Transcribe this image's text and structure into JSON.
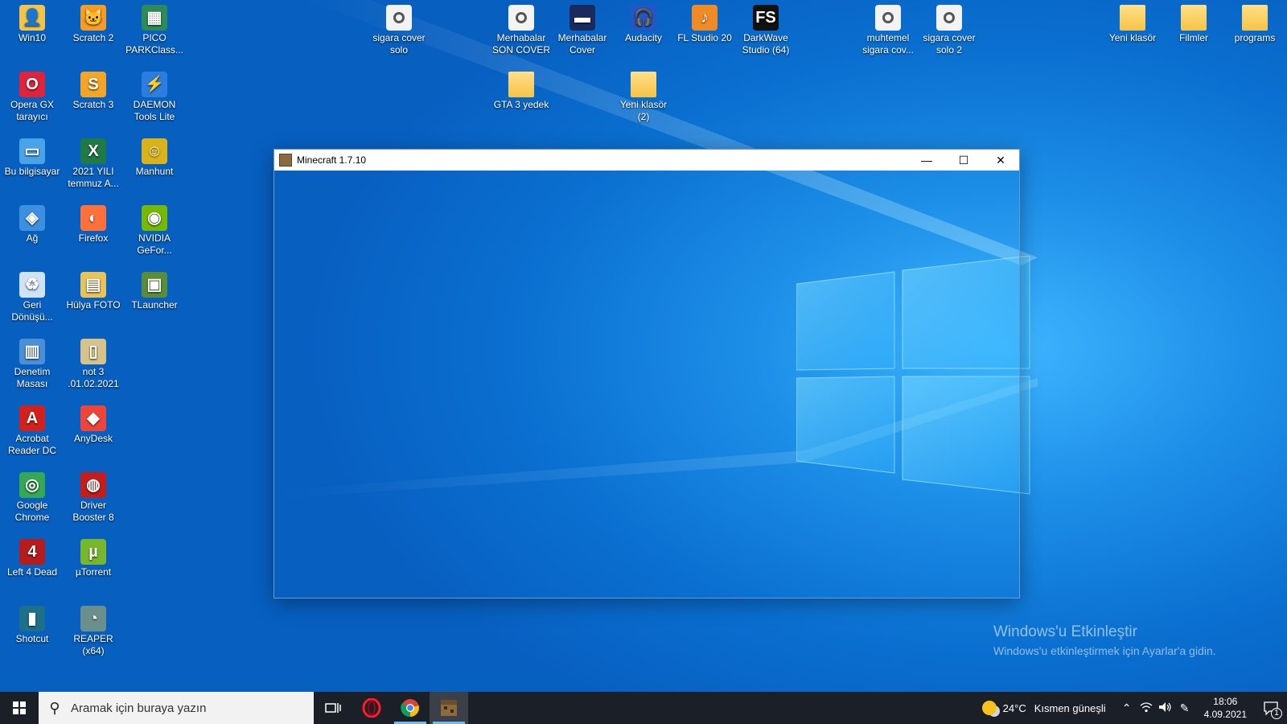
{
  "desktop": {
    "icons": [
      {
        "label": "Win10",
        "icon": "user-folder-icon",
        "color": "#f2c44a"
      },
      {
        "label": "Scratch 2",
        "icon": "scratch-cat-icon",
        "color": "#f79b27"
      },
      {
        "label": "PICO PARKClass...",
        "icon": "pico-park-icon",
        "color": "#2e8b57"
      },
      {
        "label": "Opera GX tarayıcı",
        "icon": "opera-gx-icon",
        "color": "#e0223a"
      },
      {
        "label": "Scratch 3",
        "icon": "scratch3-icon",
        "color": "#f5a524"
      },
      {
        "label": "DAEMON Tools Lite",
        "icon": "daemon-tools-icon",
        "color": "#2a7de1"
      },
      {
        "label": "Bu bilgisayar",
        "icon": "computer-icon",
        "color": "#4aa3e8"
      },
      {
        "label": "2021 YILI temmuz A...",
        "icon": "excel-file-icon",
        "color": "#1f7a45"
      },
      {
        "label": "Manhunt",
        "icon": "manhunt-icon",
        "color": "#d9b317"
      },
      {
        "label": "Ağ",
        "icon": "network-icon",
        "color": "#3d8fe0"
      },
      {
        "label": "Firefox",
        "icon": "firefox-icon",
        "color": "#ff7139"
      },
      {
        "label": "NVIDIA GeFor...",
        "icon": "nvidia-icon",
        "color": "#76b900"
      },
      {
        "label": "Geri Dönüşü...",
        "icon": "recycle-bin-icon",
        "color": "#cfe3f5"
      },
      {
        "label": "Hülya FOTO",
        "icon": "photo-folder-icon",
        "color": "#e8c35a"
      },
      {
        "label": "TLauncher",
        "icon": "tlauncher-icon",
        "color": "#5a8d3a"
      },
      {
        "label": "Denetim Masası",
        "icon": "control-panel-icon",
        "color": "#4a90d9"
      },
      {
        "label": "not 3 .01.02.2021",
        "icon": "file-icon",
        "color": "#d7c28a"
      },
      {
        "label": "Acrobat Reader DC",
        "icon": "acrobat-icon",
        "color": "#d4201c"
      },
      {
        "label": "AnyDesk",
        "icon": "anydesk-icon",
        "color": "#ef443b"
      },
      {
        "label": "Google Chrome",
        "icon": "chrome-icon",
        "color": "#34a853"
      },
      {
        "label": "Driver Booster 8",
        "icon": "driver-booster-icon",
        "color": "#c61c1c"
      },
      {
        "label": "Left 4 Dead",
        "icon": "left4dead-icon",
        "color": "#b71c1c"
      },
      {
        "label": "µTorrent",
        "icon": "utorrent-icon",
        "color": "#78b72b"
      },
      {
        "label": "Shotcut",
        "icon": "shotcut-icon",
        "color": "#1d6f8a"
      },
      {
        "label": "REAPER (x64)",
        "icon": "reaper-icon",
        "color": "#6b8f8a"
      },
      {
        "label": "sigara cover solo",
        "icon": "audio-project-icon",
        "color": "#f3f3f3"
      },
      {
        "label": "Merhabalar SON COVER",
        "icon": "audio-project-icon",
        "color": "#f3f3f3"
      },
      {
        "label": "Merhabalar Cover",
        "icon": "video-file-icon",
        "color": "#1a2a5e"
      },
      {
        "label": "Audacity",
        "icon": "audacity-icon",
        "color": "#2456c5"
      },
      {
        "label": "FL Studio 20",
        "icon": "fl-studio-icon",
        "color": "#f08a24"
      },
      {
        "label": "DarkWave Studio (64)",
        "icon": "darkwave-icon",
        "color": "#111111"
      },
      {
        "label": "GTA 3 yedek",
        "icon": "folder-icon",
        "color": "#f6c344"
      },
      {
        "label": "Yeni klasör (2)",
        "icon": "folder-icon",
        "color": "#f6c344"
      },
      {
        "label": "muhtemel sigara cov...",
        "icon": "audio-project-icon",
        "color": "#f3f3f3"
      },
      {
        "label": "sigara cover solo 2",
        "icon": "audio-project-icon",
        "color": "#f3f3f3"
      },
      {
        "label": "Yeni klasör",
        "icon": "folder-icon",
        "color": "#f6c344"
      },
      {
        "label": "Filmler",
        "icon": "folder-icon",
        "color": "#f6c344"
      },
      {
        "label": "programs",
        "icon": "folder-icon",
        "color": "#f6c344"
      }
    ]
  },
  "window": {
    "title": "Minecraft 1.7.10",
    "icon": "minecraft-icon",
    "minimize_symbol": "—",
    "maximize_symbol": "☐",
    "close_symbol": "✕"
  },
  "watermark": {
    "line1": "Windows'u Etkinleştir",
    "line2": "Windows'u etkinleştirmek için Ayarlar'a gidin."
  },
  "taskbar": {
    "search_placeholder": "Aramak için buraya yazın",
    "apps": [
      {
        "name": "task-view",
        "icon": "task-view-icon"
      },
      {
        "name": "opera",
        "icon": "opera-icon"
      },
      {
        "name": "chrome",
        "icon": "chrome-icon"
      },
      {
        "name": "minecraft",
        "icon": "minecraft-icon"
      }
    ],
    "weather_temp": "24°C",
    "weather_text": "Kısmen güneşli",
    "time": "18:06",
    "date": "4.09.2021",
    "notification_count": "1"
  },
  "colors": {
    "taskbar": "#1b1f27",
    "accent": "#76b9ed"
  }
}
